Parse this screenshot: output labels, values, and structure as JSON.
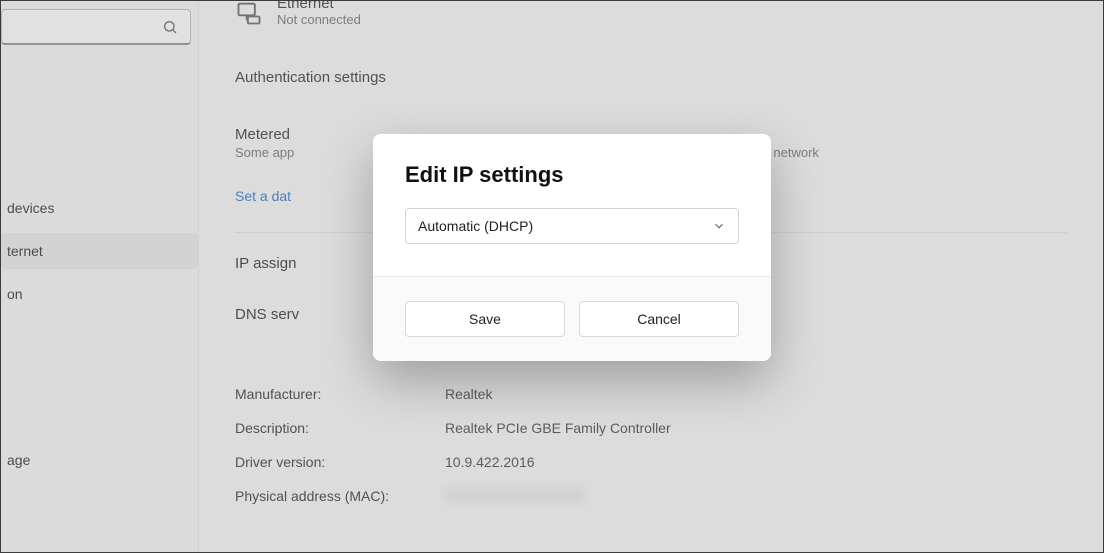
{
  "sidebar": {
    "items": [
      {
        "label": "devices"
      },
      {
        "label": "ternet"
      },
      {
        "label": "on"
      },
      {
        "label": "age"
      }
    ]
  },
  "connection": {
    "name": "Ethernet",
    "status": "Not connected"
  },
  "sections": {
    "auth": "Authentication settings",
    "metered_title": "Metered",
    "metered_sub_left": "Some app",
    "metered_sub_right": "connected to this network",
    "data_limit_link": "Set a dat",
    "ip_assign": "IP assign",
    "dns": "DNS serv"
  },
  "details": {
    "rows": [
      {
        "key": "Manufacturer:",
        "val": "Realtek"
      },
      {
        "key": "Description:",
        "val": "Realtek PCIe GBE Family Controller"
      },
      {
        "key": "Driver version:",
        "val": "10.9.422.2016"
      },
      {
        "key": "Physical address (MAC):",
        "val": ""
      }
    ]
  },
  "dialog": {
    "title": "Edit IP settings",
    "select_value": "Automatic (DHCP)",
    "save_label": "Save",
    "cancel_label": "Cancel"
  }
}
